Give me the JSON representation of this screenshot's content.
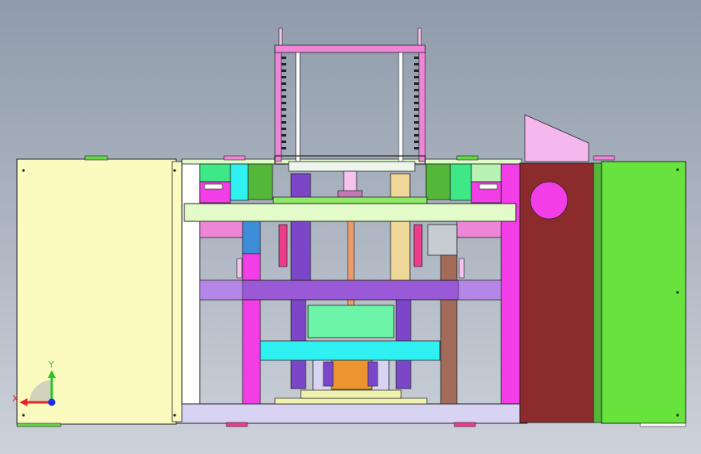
{
  "view": {
    "type": "cad-front-view",
    "background": [
      "#8f9bab",
      "#cdd2da"
    ],
    "triad": {
      "x_label": "X",
      "y_label": "Y",
      "x_color": "#e8262a",
      "y_color": "#28c428",
      "z_color": "#1c2ee0"
    }
  },
  "palette": {
    "cream_panel": "#fbfbc0",
    "green_panel": "#68e23c",
    "brown_panel": "#8c2b2b",
    "magenta": "#f33ee8",
    "purple": "#9a5ad8",
    "cyan": "#2ff1f1",
    "mint": "#6cf5a9",
    "orange": "#ec9530",
    "tan": "#f0d79a",
    "lavender": "#d8d2f3",
    "light_green": "#e2fbc8",
    "pink": "#ee86d8",
    "steel": "#c7cbd2"
  }
}
